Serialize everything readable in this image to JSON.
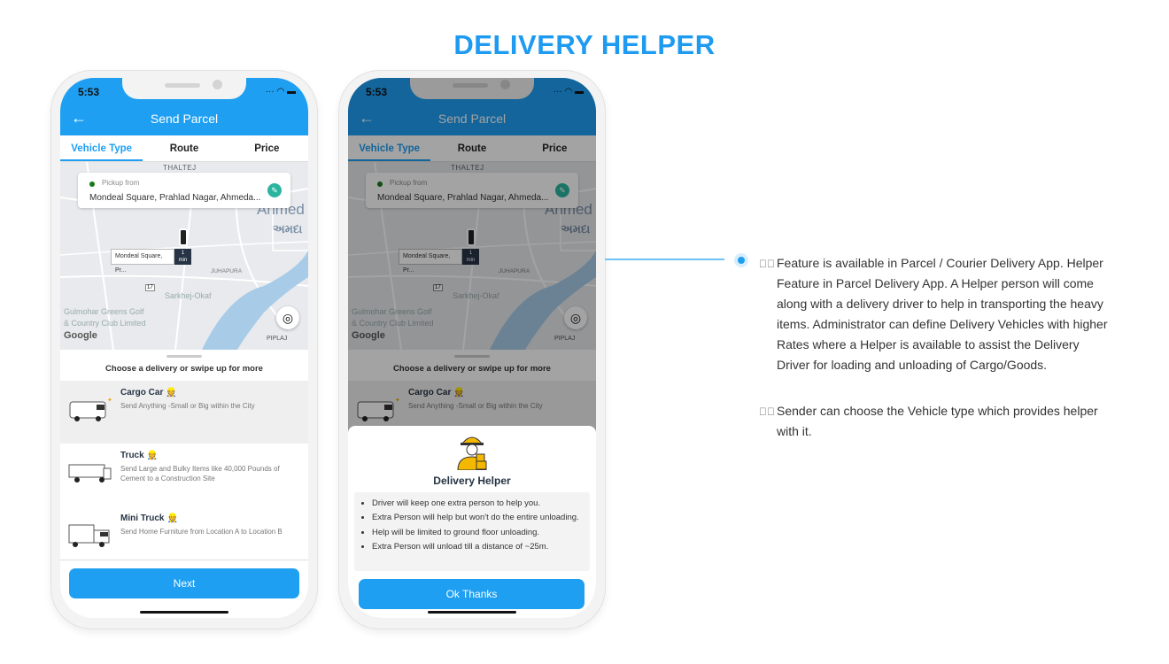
{
  "page_title": "DELIVERY HELPER",
  "colors": {
    "accent": "#1e9ff2",
    "title": "#1e9bf0",
    "helper_badge": "#e9a800"
  },
  "status_bar": {
    "time": "5:53",
    "icons": "signal wifi battery"
  },
  "phone1": {
    "nav_title": "Send Parcel",
    "tabs": [
      "Vehicle Type",
      "Route",
      "Price"
    ],
    "active_tab": "Vehicle Type",
    "pickup": {
      "label": "Pickup from",
      "address": "Mondeal Square, Prahlad Nagar, Ahmeda..."
    },
    "map": {
      "marker_label": "Mondeal Square, Pr...",
      "eta_value": "1",
      "eta_unit": "min",
      "places": [
        "THALTEJ",
        "Ahmed",
        "અમદા",
        "JUHAPURA",
        "Sarkhej-Okaf",
        "Gulmohar Greens Golf",
        "& Country Club Limited",
        "PIPLAJ",
        "17"
      ],
      "logo": "Google"
    },
    "sheet_hint": "Choose a delivery or swipe up for more",
    "vehicles": [
      {
        "name": "Cargo Car",
        "desc": "Send Anything -Small or Big within the City",
        "selected": true
      },
      {
        "name": "Truck",
        "desc": "Send Large and Bulky Items like 40,000 Pounds of Cement to a Construction Site",
        "selected": false
      },
      {
        "name": "Mini Truck",
        "desc": "Send Home Furniture from Location A to Location B",
        "selected": false
      }
    ],
    "next_label": "Next"
  },
  "phone2": {
    "modal_title": "Delivery Helper",
    "bullets": [
      "Driver will keep one extra person to help you.",
      "Extra Person will help but won't do the entire unloading.",
      "Help will be limited to ground floor unloading.",
      "Extra Person will unload till a distance of ~25m."
    ],
    "ok_label": "Ok Thanks"
  },
  "features": [
    "Feature is available in Parcel / Courier Delivery App. Helper Feature in Parcel Delivery App. A Helper person will come along with a delivery driver to help in transporting the heavy items. Administrator can define Delivery Vehicles with higher Rates where a Helper is available to assist the Delivery Driver for loading and unloading of Cargo/Goods.",
    "Sender can choose the Vehicle type which provides helper with it."
  ]
}
